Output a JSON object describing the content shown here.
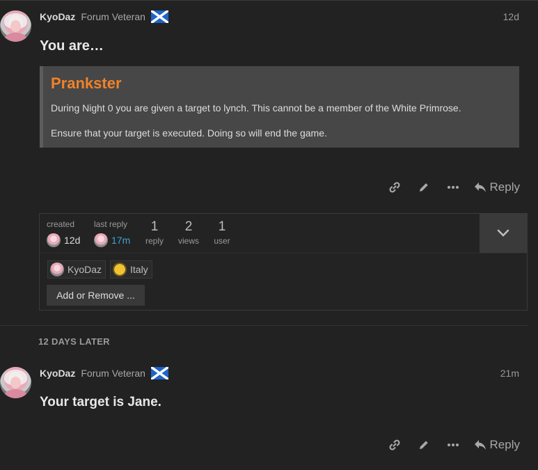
{
  "posts": [
    {
      "username": "KyoDaz",
      "user_title": "Forum Veteran",
      "flag_icon": "scotland-flag-icon",
      "date": "12d",
      "heading": "You are…",
      "quote": {
        "title": "Prankster",
        "paragraphs": [
          "During Night 0 you are given a target to lynch. This cannot be a member of the White Primrose.",
          "Ensure that your target is executed. Doing so will end the game."
        ]
      },
      "reply_label": "Reply"
    },
    {
      "username": "KyoDaz",
      "user_title": "Forum Veteran",
      "flag_icon": "scotland-flag-icon",
      "date": "21m",
      "heading": "Your target is Jane.",
      "reply_label": "Reply"
    }
  ],
  "topic_map": {
    "created_label": "created",
    "created_value": "12d",
    "last_reply_label": "last reply",
    "last_reply_value": "17m",
    "stats": [
      {
        "number": "1",
        "label": "reply"
      },
      {
        "number": "2",
        "label": "views"
      },
      {
        "number": "1",
        "label": "user"
      }
    ],
    "participants": [
      "KyoDaz",
      "Italy"
    ],
    "add_remove_label": "Add or Remove ..."
  },
  "time_gap_label": "12 DAYS LATER",
  "colors": {
    "background": "#222222",
    "quote_title": "#f0822a",
    "link": "#3ea2d1",
    "quote_bg": "#474747"
  },
  "icons": [
    "link-icon",
    "pencil-icon",
    "more-icon",
    "reply-icon",
    "chevron-down-icon"
  ]
}
